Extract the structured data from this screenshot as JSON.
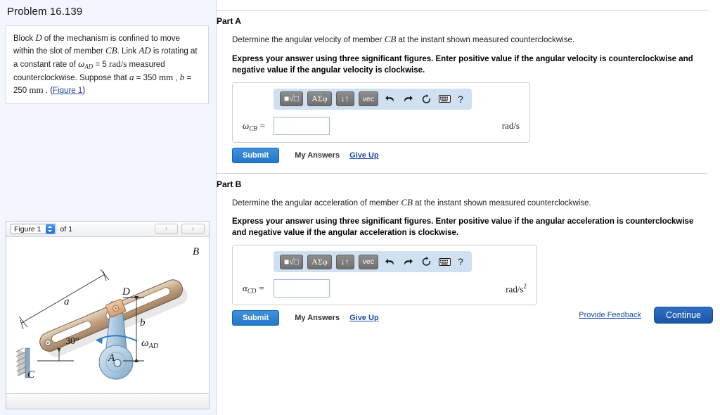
{
  "sidebar": {
    "problem_title": "Problem 16.139",
    "statement": {
      "line1_a": "Block ",
      "block_symbol": "D",
      "line1_b": " of the mechanism is confined to move within the",
      "line2_a": "slot of member ",
      "member_symbol": "CB",
      "line2_b": ". Link ",
      "link_symbol": "AD",
      "line2_c": " is rotating at a constant",
      "line3_a": "rate of ",
      "omega_symbol": "ω",
      "omega_sub": "AD",
      "omega_eq": " = 5 ",
      "omega_unit": "rad/s",
      "line3_b": " measured counterclockwise.",
      "line4_a": "Suppose that ",
      "a_symbol": "a",
      "a_value": " = 350 ",
      "mm_unit": "mm",
      "comma": " , ",
      "b_symbol": "b",
      "b_value": " = 250 ",
      "period": " . (",
      "figure_link": "Figure 1",
      "close_paren": ")"
    },
    "figure_panel": {
      "select_value": "Figure 1",
      "of_label": "of 1",
      "prev_label": "‹",
      "next_label": "›",
      "diagram": {
        "label_B": "B",
        "label_C": "C",
        "label_D": "D",
        "label_A": "A",
        "label_a": "a",
        "label_b": "b",
        "label_angle": "30°",
        "label_omega": "ω",
        "label_omega_sub": "AD"
      }
    }
  },
  "main": {
    "parts": [
      {
        "heading": "Part A",
        "question_pre": "Determine the angular velocity of member ",
        "question_symbol": "CB",
        "question_post": " at the instant shown measured counterclockwise.",
        "instruction": "Express your answer using three significant figures. Enter positive value if the angular velocity is counterclockwise and negative value if the angular velocity is clockwise.",
        "answer_label_symbol": "ω",
        "answer_label_sub": "CB",
        "answer_label_eq": " =",
        "answer_value": "",
        "unit": "rad/s",
        "unit_sup": "",
        "submit_label": "Submit",
        "my_answers_label": "My Answers",
        "give_up_label": "Give Up"
      },
      {
        "heading": "Part B",
        "question_pre": "Determine the angular acceleration of member ",
        "question_symbol": "CB",
        "question_post": " at the instant shown measured counterclockwise.",
        "instruction": "Express your answer using three significant figures. Enter positive value if the angular acceleration is counterclockwise and negative value if the angular acceleration is clockwise.",
        "answer_label_symbol": "α",
        "answer_label_sub": "CD",
        "answer_label_eq": " =",
        "answer_value": "",
        "unit": "rad/s",
        "unit_sup": "2",
        "submit_label": "Submit",
        "my_answers_label": "My Answers",
        "give_up_label": "Give Up"
      }
    ],
    "toolbar": {
      "template_label": "■√□",
      "greek_label": "ΑΣφ",
      "arrows_label": "↓↑",
      "vector_label": "vec",
      "undo_name": "undo-icon",
      "redo_name": "redo-icon",
      "reset_name": "reset-icon",
      "keyboard_name": "keyboard-icon",
      "help_label": "?"
    },
    "footer": {
      "feedback_label": "Provide Feedback",
      "continue_label": "Continue"
    }
  },
  "colors": {
    "accent_blue": "#2476c8",
    "link_blue": "#1d4fa5",
    "toolbar_bg": "#cfe0f0",
    "sidebar_bg": "#f2f6fc",
    "member_tan": "#c9ab89",
    "link_blue_part": "#a9c8e0"
  }
}
